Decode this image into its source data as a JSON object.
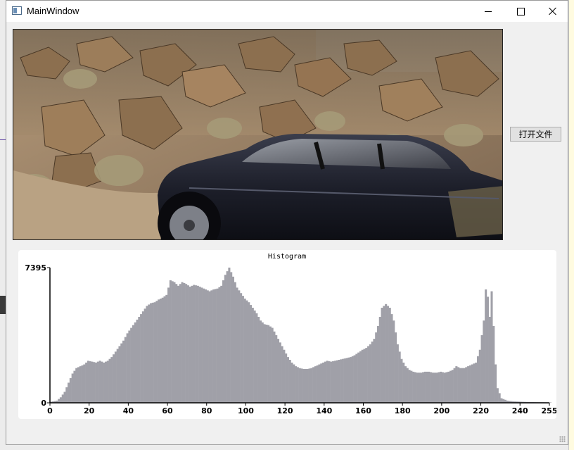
{
  "window": {
    "title": "MainWindow",
    "minimize_icon": "minimize-icon",
    "maximize_icon": "maximize-icon",
    "close_icon": "close-icon"
  },
  "toolbar": {
    "open_file_label": "打开文件"
  },
  "image": {
    "description_icon": "photo-car-on-rocky-hillside"
  },
  "chart_data": {
    "type": "bar",
    "title": "Histogram",
    "xlabel": "",
    "ylabel": "",
    "xlim": [
      0,
      255
    ],
    "ylim": [
      0,
      7395
    ],
    "x_ticks": [
      0,
      20,
      40,
      60,
      80,
      100,
      120,
      140,
      160,
      180,
      200,
      220,
      240,
      255
    ],
    "y_ticks": [
      0,
      7395
    ],
    "bar_color": "#a0a0a8",
    "grid": false,
    "anchors": [
      [
        0,
        60
      ],
      [
        3,
        120
      ],
      [
        5,
        300
      ],
      [
        7,
        600
      ],
      [
        9,
        1100
      ],
      [
        11,
        1600
      ],
      [
        13,
        1900
      ],
      [
        15,
        2000
      ],
      [
        17,
        2100
      ],
      [
        19,
        2300
      ],
      [
        21,
        2250
      ],
      [
        23,
        2200
      ],
      [
        25,
        2300
      ],
      [
        27,
        2200
      ],
      [
        29,
        2300
      ],
      [
        31,
        2500
      ],
      [
        33,
        2800
      ],
      [
        35,
        3100
      ],
      [
        37,
        3400
      ],
      [
        39,
        3800
      ],
      [
        41,
        4100
      ],
      [
        43,
        4400
      ],
      [
        45,
        4700
      ],
      [
        47,
        5000
      ],
      [
        49,
        5300
      ],
      [
        51,
        5450
      ],
      [
        53,
        5500
      ],
      [
        55,
        5650
      ],
      [
        57,
        5750
      ],
      [
        59,
        5900
      ],
      [
        61,
        6700
      ],
      [
        63,
        6600
      ],
      [
        65,
        6400
      ],
      [
        67,
        6600
      ],
      [
        69,
        6500
      ],
      [
        71,
        6350
      ],
      [
        73,
        6450
      ],
      [
        75,
        6400
      ],
      [
        77,
        6300
      ],
      [
        79,
        6200
      ],
      [
        81,
        6100
      ],
      [
        83,
        6200
      ],
      [
        85,
        6250
      ],
      [
        87,
        6400
      ],
      [
        89,
        7000
      ],
      [
        91,
        7395
      ],
      [
        93,
        6900
      ],
      [
        95,
        6300
      ],
      [
        97,
        6000
      ],
      [
        99,
        5700
      ],
      [
        101,
        5500
      ],
      [
        103,
        5200
      ],
      [
        105,
        4900
      ],
      [
        107,
        4500
      ],
      [
        109,
        4300
      ],
      [
        111,
        4250
      ],
      [
        113,
        4100
      ],
      [
        115,
        3700
      ],
      [
        117,
        3300
      ],
      [
        119,
        2900
      ],
      [
        121,
        2500
      ],
      [
        123,
        2200
      ],
      [
        125,
        2000
      ],
      [
        127,
        1900
      ],
      [
        129,
        1850
      ],
      [
        131,
        1850
      ],
      [
        133,
        1900
      ],
      [
        135,
        2000
      ],
      [
        137,
        2100
      ],
      [
        139,
        2200
      ],
      [
        141,
        2300
      ],
      [
        143,
        2250
      ],
      [
        145,
        2300
      ],
      [
        147,
        2350
      ],
      [
        149,
        2400
      ],
      [
        151,
        2450
      ],
      [
        153,
        2500
      ],
      [
        155,
        2600
      ],
      [
        157,
        2750
      ],
      [
        159,
        2900
      ],
      [
        161,
        3000
      ],
      [
        163,
        3200
      ],
      [
        165,
        3500
      ],
      [
        167,
        4200
      ],
      [
        169,
        5200
      ],
      [
        171,
        5400
      ],
      [
        173,
        5200
      ],
      [
        175,
        4500
      ],
      [
        177,
        3200
      ],
      [
        179,
        2400
      ],
      [
        181,
        2000
      ],
      [
        183,
        1800
      ],
      [
        185,
        1700
      ],
      [
        187,
        1650
      ],
      [
        189,
        1650
      ],
      [
        191,
        1700
      ],
      [
        193,
        1700
      ],
      [
        195,
        1650
      ],
      [
        197,
        1650
      ],
      [
        199,
        1700
      ],
      [
        201,
        1650
      ],
      [
        203,
        1700
      ],
      [
        205,
        1800
      ],
      [
        207,
        2000
      ],
      [
        209,
        1900
      ],
      [
        211,
        1900
      ],
      [
        213,
        2000
      ],
      [
        215,
        2100
      ],
      [
        217,
        2200
      ],
      [
        219,
        2900
      ],
      [
        221,
        4500
      ],
      [
        222,
        6200
      ],
      [
        223,
        5800
      ],
      [
        224,
        4700
      ],
      [
        225,
        6100
      ],
      [
        226,
        4200
      ],
      [
        227,
        2100
      ],
      [
        228,
        800
      ],
      [
        230,
        250
      ],
      [
        233,
        120
      ],
      [
        236,
        80
      ],
      [
        240,
        60
      ],
      [
        245,
        40
      ],
      [
        250,
        30
      ],
      [
        255,
        20
      ]
    ]
  }
}
